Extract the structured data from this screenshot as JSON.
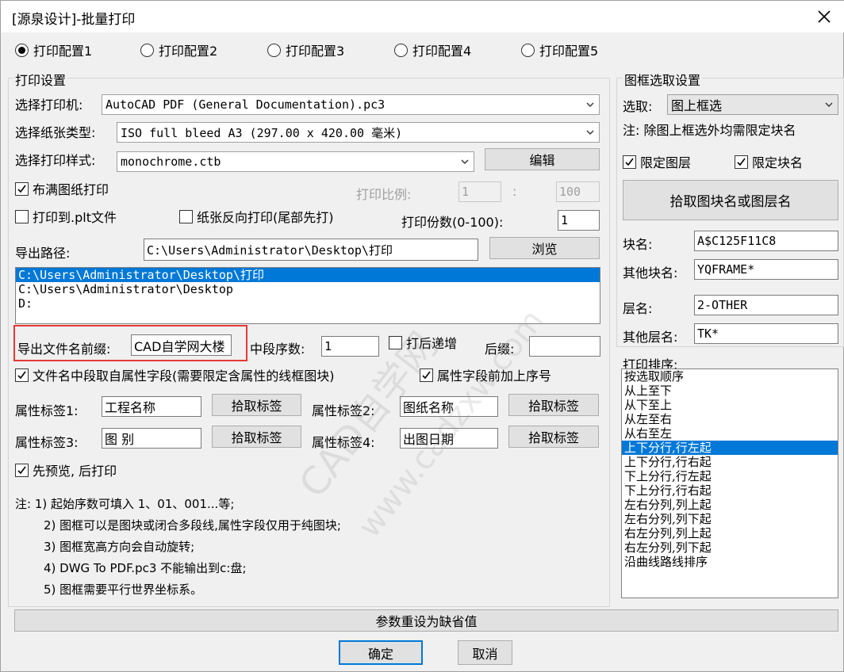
{
  "window": {
    "title": "[源泉设计]-批量打印"
  },
  "configs": [
    {
      "label": "打印配置1",
      "checked": true
    },
    {
      "label": "打印配置2",
      "checked": false
    },
    {
      "label": "打印配置3",
      "checked": false
    },
    {
      "label": "打印配置4",
      "checked": false
    },
    {
      "label": "打印配置5",
      "checked": false
    }
  ],
  "print": {
    "group_title": "打印设置",
    "printer_label": "选择打印机:",
    "printer_value": "AutoCAD PDF (General Documentation).pc3",
    "paper_label": "选择纸张类型:",
    "paper_value": "ISO full bleed A3 (297.00 x 420.00 毫米)",
    "style_label": "选择打印样式:",
    "style_value": "monochrome.ctb",
    "edit_button": "编辑",
    "fill_paper": "布满图纸打印",
    "scale_label": "打印比例:",
    "scale_left": "1",
    "scale_colon": ":",
    "scale_right": "100",
    "plt_file": "打印到.plt文件",
    "reverse": "纸张反向打印(尾部先打)",
    "copies_label": "打印份数(0-100):",
    "copies_value": "1",
    "path_label": "导出路径:",
    "path_value": "C:\\Users\\Administrator\\Desktop\\打印",
    "browse_button": "浏览",
    "path_list": [
      "C:\\Users\\Administrator\\Desktop\\打印",
      "C:\\Users\\Administrator\\Desktop",
      "D:"
    ],
    "prefix_label": "导出文件名前缀:",
    "prefix_value": "CAD自学网大楼",
    "mid_label": "中段序数:",
    "mid_value": "1",
    "increment": "打后递增",
    "suffix_label": "后缀:",
    "suffix_value": "",
    "mid_from_attr": "文件名中段取自属性字段(需要限定含属性的线框图块)",
    "attr_prefix_seq": "属性字段前加上序号",
    "attr1_label": "属性标签1:",
    "attr1_value": "工程名称",
    "attr2_label": "属性标签2:",
    "attr2_value": "图纸名称",
    "attr3_label": "属性标签3:",
    "attr3_value": "图 别",
    "attr4_label": "属性标签4:",
    "attr4_value": "出图日期",
    "pick_tag": "拾取标签",
    "preview": "先预览, 后打印",
    "notes": [
      "注: 1) 起始序数可填入 1、01、001...等;",
      "2) 图框可以是图块或闭合多段线,属性字段仅用于纯图块;",
      "3) 图框宽高方向会自动旋转;",
      "4) DWG To PDF.pc3 不能输出到c:盘;",
      "5) 图框需要平行世界坐标系。"
    ]
  },
  "frame": {
    "group_title": "图框选取设置",
    "select_label": "选取:",
    "select_value": "图上框选",
    "note": "注: 除图上框选外均需限定块名",
    "limit_layer": "限定图层",
    "limit_block": "限定块名",
    "pick_button": "拾取图块名或图层名",
    "block_label": "块名:",
    "block_value": "A$C125F11C8",
    "other_block_label": "其他块名:",
    "other_block_value": "YQFRAME*",
    "layer_label": "层名:",
    "layer_value": "2-OTHER",
    "other_layer_label": "其他层名:",
    "other_layer_value": "TK*"
  },
  "sort": {
    "label": "打印排序:",
    "items": [
      "按选取顺序",
      "从上至下",
      "从下至上",
      "从左至右",
      "从右至左",
      "上下分行,行左起",
      "上下分行,行右起",
      "下上分行,行左起",
      "下上分行,行右起",
      "左右分列,列上起",
      "左右分列,列下起",
      "右左分列,列上起",
      "右左分列,列下起",
      "沿曲线路线排序"
    ],
    "selected_index": 5
  },
  "footer": {
    "reset_button": "参数重设为缺省值",
    "ok_button": "确定",
    "cancel_button": "取消"
  }
}
